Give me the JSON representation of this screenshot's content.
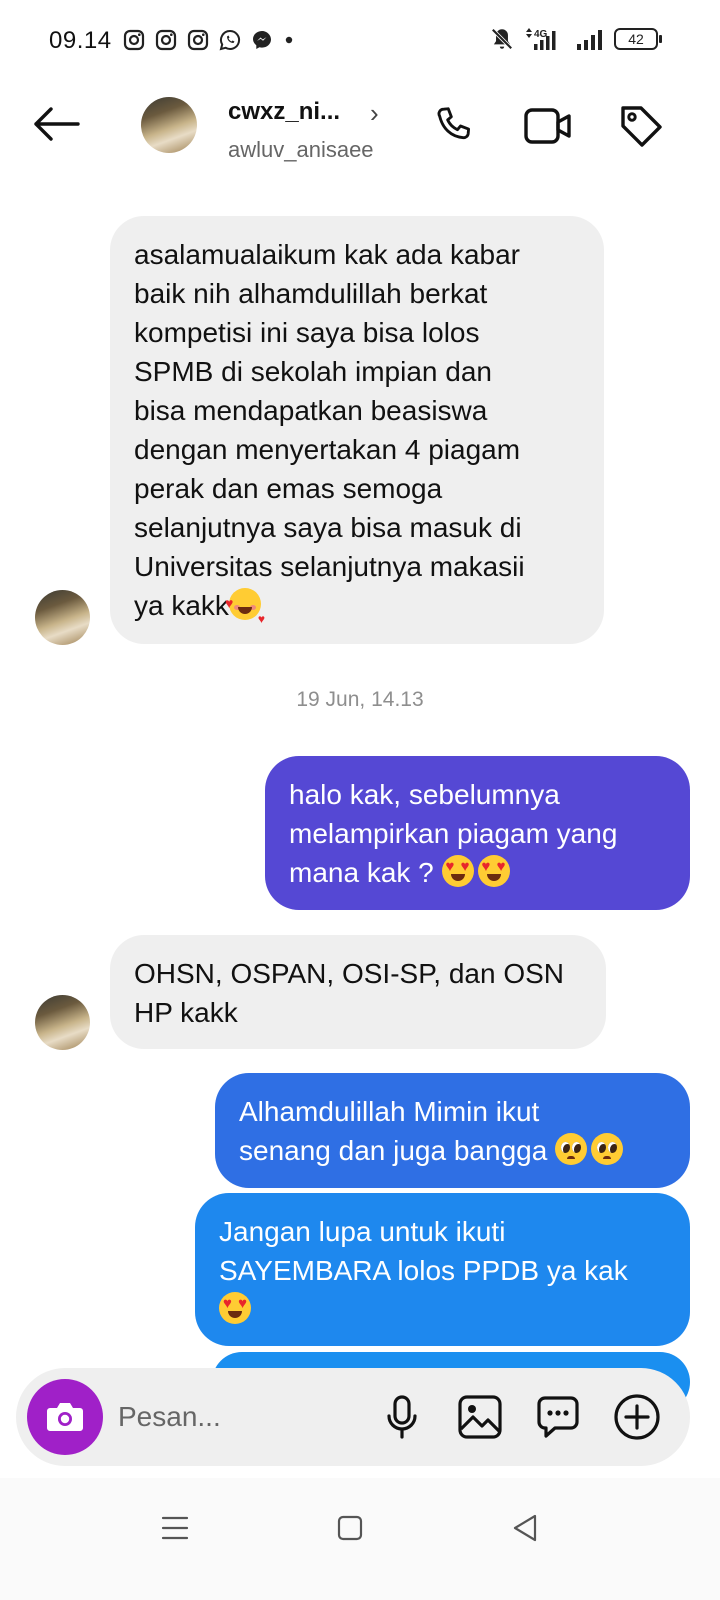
{
  "status_bar": {
    "time": "09.14",
    "network": "4G",
    "battery": "42",
    "left_icons": [
      "instagram-icon",
      "instagram-icon",
      "instagram-icon",
      "whatsapp-icon",
      "messenger-icon",
      "dot-icon"
    ],
    "right_icons": [
      "mute-bell-icon",
      "signal-icon",
      "signal-icon",
      "battery-icon"
    ]
  },
  "header": {
    "contact_name": "cwxz_ni...",
    "username": "awluv_anisaee",
    "icons": [
      "back-arrow-icon",
      "phone-icon",
      "video-icon",
      "tag-icon"
    ]
  },
  "messages": [
    {
      "side": "in",
      "lines": [
        "asalamualaikum kak ada kabar",
        "baik nih alhamdulillah berkat",
        "kompetisi ini saya bisa lolos",
        "SPMB di sekolah impian dan",
        "bisa mendapatkan beasiswa",
        "dengan menyertakan 4 piagam",
        "perak dan emas semoga",
        "selanjutnya saya bisa masuk di",
        "Universitas selanjutnya makasii",
        "ya kakk"
      ],
      "emoji": "smiling-face-with-hearts"
    },
    {
      "side": "out",
      "lines": [
        "halo kak, sebelumnya",
        "melampirkan piagam yang",
        "mana kak ?"
      ],
      "emoji": "heart-eyes x2"
    },
    {
      "side": "in",
      "lines": [
        "OHSN, OSPAN, OSI-SP, dan OSN",
        "HP kakk"
      ]
    },
    {
      "side": "out",
      "lines": [
        "Alhamdulillah Mimin ikut",
        "senang dan juga bangga"
      ],
      "emoji": "pleading-face x2"
    },
    {
      "side": "out",
      "lines": [
        "Jangan lupa untuk ikuti",
        "SAYEMBARA lolos PPDB ya kak"
      ],
      "emoji": "heart-eyes"
    }
  ],
  "timestamp": "19 Jun, 14.13",
  "colors": {
    "incoming_bubble": "#efefef",
    "outgoing_bubble_1": "#5548d4",
    "outgoing_bubble_2": "#2f6fe4",
    "outgoing_bubble_3": "#1e88ee",
    "outgoing_bubble_4": "#1a8ff0",
    "camera_button": "#a020c8"
  },
  "composer": {
    "placeholder": "Pesan...",
    "icons": [
      "camera-icon",
      "microphone-icon",
      "gallery-icon",
      "sticker-icon",
      "plus-icon"
    ]
  },
  "nav_bar": {
    "icons": [
      "menu-icon",
      "home-square-icon",
      "back-triangle-icon"
    ]
  }
}
